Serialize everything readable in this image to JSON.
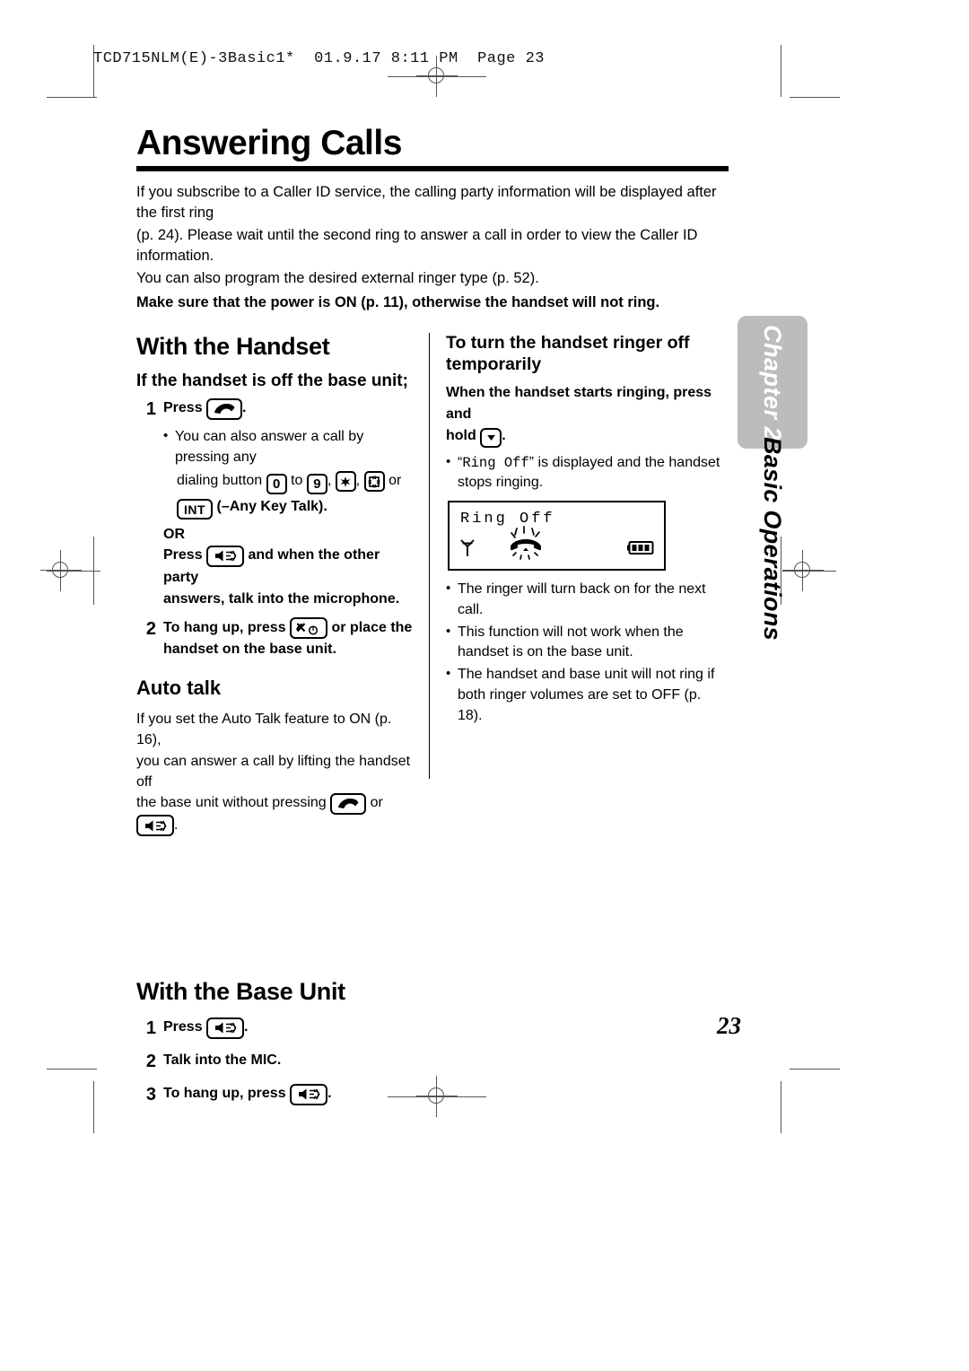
{
  "printer_slug": "TCD715NLM(E)-3Basic1*  01.9.17 8:11 PM  Page 23",
  "title": "Answering Calls",
  "intro": {
    "line1": "If you subscribe to a Caller ID service, the calling party information will be displayed after the first ring",
    "line2": "(p. 24). Please wait until the second ring to answer a call in order to view the Caller ID information.",
    "line3": "You can also program the desired external ringer type (p. 52).",
    "bold_note": "Make sure that the power is ON (p. 11), otherwise the handset will not ring."
  },
  "left_column": {
    "section_title": "With the Handset",
    "subheading": "If the handset is off the base unit;",
    "step1": {
      "num": "1",
      "press_label": "Press",
      "key": "talk-handset-key",
      "period": "."
    },
    "bullet1": {
      "part1": "You can also answer a call by pressing any",
      "part2_pre": "dialing button",
      "key_0": "0",
      "to": "to",
      "key_9": "9",
      "comma1": ",",
      "key_star": "star-key",
      "comma2": ",",
      "key_pound": "pound-key",
      "or": "or",
      "key_int": "INT",
      "suffix": "(–Any Key Talk)."
    },
    "or_label": "OR",
    "or_text_pre": "Press",
    "or_key": "speakerphone-key",
    "or_text_post": "and when the other party",
    "or_text_line2": "answers, talk into the microphone.",
    "step2": {
      "num": "2",
      "text_pre": "To hang up, press",
      "key": "off-key",
      "text_post": "or place the",
      "text_line2": "handset on the base unit."
    },
    "autotalk_title": "Auto talk",
    "autotalk_l1": "If you set the Auto Talk feature to ON (p. 16),",
    "autotalk_l2": "you can answer a call by lifting the handset off",
    "autotalk_l3_pre": "the base unit without pressing",
    "autotalk_or": "or",
    "autotalk_end": "."
  },
  "right_column": {
    "heading_l1": "To turn the handset ringer off",
    "heading_l2": "temporarily",
    "instruction_l1": "When the handset starts ringing, press and",
    "instruction_l2_pre": "hold",
    "instruction_key": "down-arrow-key",
    "instruction_l2_post": ".",
    "bullet_ringoff_pre": "“",
    "bullet_ringoff_mono": "Ring Off",
    "bullet_ringoff_post": "” is displayed and the handset",
    "bullet_ringoff_l2": "stops ringing.",
    "lcd": {
      "text": "Ring Off",
      "icon_antenna": "antenna-icon",
      "icon_ringing": "ringing-handset-icon",
      "icon_battery": "battery-full-icon"
    },
    "notes": [
      "The ringer will turn back on for the next call.",
      "This function will not work when the handset is on the base unit.",
      "The handset and base unit will not ring if both ringer volumes are set to OFF (p. 18)."
    ]
  },
  "base_unit": {
    "section_title": "With the Base Unit",
    "steps": [
      {
        "num": "1",
        "pre": "Press",
        "key": "speakerphone-key",
        "post": "."
      },
      {
        "num": "2",
        "pre": "Talk into the MIC.",
        "key": "",
        "post": ""
      },
      {
        "num": "3",
        "pre": "To hang up, press",
        "key": "speakerphone-key",
        "post": "."
      }
    ]
  },
  "side_tab": {
    "chapter": "Chapter 2",
    "section": "Basic Operations",
    "tab_color": "#bcbcbc"
  },
  "page_number": "23"
}
